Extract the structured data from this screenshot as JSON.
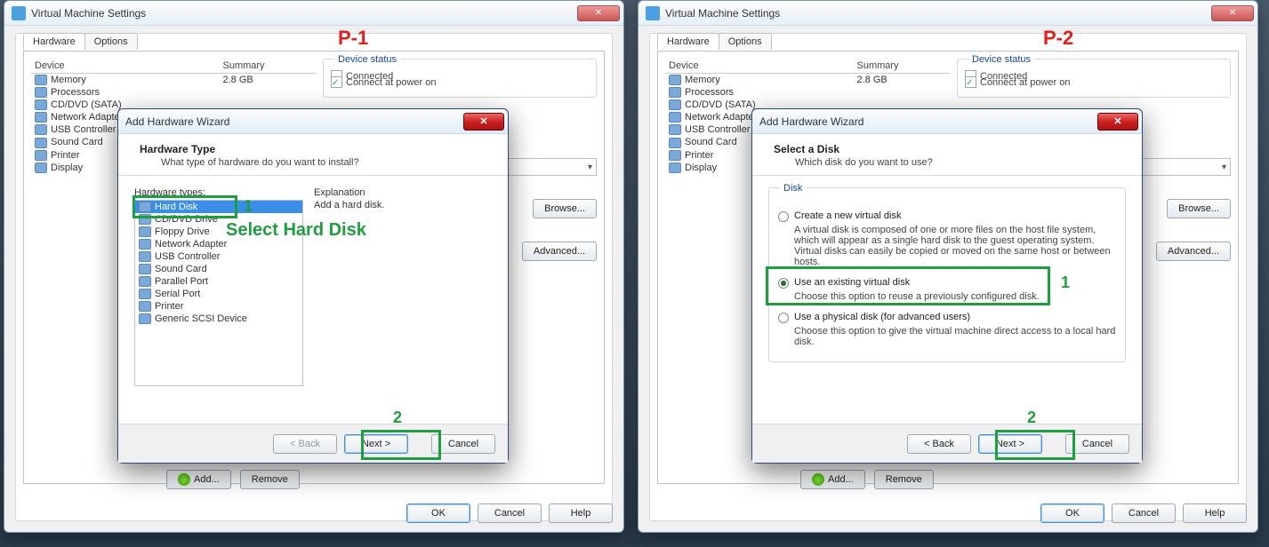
{
  "p1_label": "P-1",
  "p2_label": "P-2",
  "settings": {
    "title": "Virtual Machine Settings",
    "tabs": {
      "hardware": "Hardware",
      "options": "Options"
    },
    "cols": {
      "device": "Device",
      "summary": "Summary"
    },
    "devices": [
      {
        "name": "Memory",
        "summary": "2.8 GB"
      },
      {
        "name": "Processors",
        "summary": ""
      },
      {
        "name": "CD/DVD (SATA)",
        "summary": ""
      },
      {
        "name": "Network Adapter",
        "summary": ""
      },
      {
        "name": "USB Controller",
        "summary": ""
      },
      {
        "name": "Sound Card",
        "summary": ""
      },
      {
        "name": "Printer",
        "summary": ""
      },
      {
        "name": "Display",
        "summary": ""
      }
    ],
    "status_group": "Device status",
    "connected": "Connected",
    "connect_power": "Connect at power on",
    "browse": "Browse...",
    "advanced": "Advanced...",
    "add": "Add...",
    "remove": "Remove",
    "ok": "OK",
    "cancel": "Cancel",
    "help": "Help"
  },
  "wiz_common": {
    "title": "Add Hardware Wizard",
    "back": "< Back",
    "next": "Next >",
    "cancel": "Cancel"
  },
  "wiz1": {
    "head1": "Hardware Type",
    "head2": "What type of hardware do you want to install?",
    "list_label": "Hardware types:",
    "items": [
      "Hard Disk",
      "CD/DVD Drive",
      "Floppy Drive",
      "Network Adapter",
      "USB Controller",
      "Sound Card",
      "Parallel Port",
      "Serial Port",
      "Printer",
      "Generic SCSI Device"
    ],
    "expl_label": "Explanation",
    "expl_text": "Add a hard disk."
  },
  "wiz2": {
    "head1": "Select a Disk",
    "head2": "Which disk do you want to use?",
    "group": "Disk",
    "r1_label": "Create a new virtual disk",
    "r1_desc": "A virtual disk is composed of one or more files on the host file system, which will appear as a single hard disk to the guest operating system. Virtual disks can easily be copied or moved on the same host or between hosts.",
    "r2_label": "Use an existing virtual disk",
    "r2_desc": "Choose this option to reuse a previously configured disk.",
    "r3_label": "Use a physical disk (for advanced users)",
    "r3_desc": "Choose this option to give the virtual machine direct access to a local hard disk."
  },
  "anno": {
    "one": "1",
    "two": "2",
    "select_hd": "Select Hard Disk"
  }
}
